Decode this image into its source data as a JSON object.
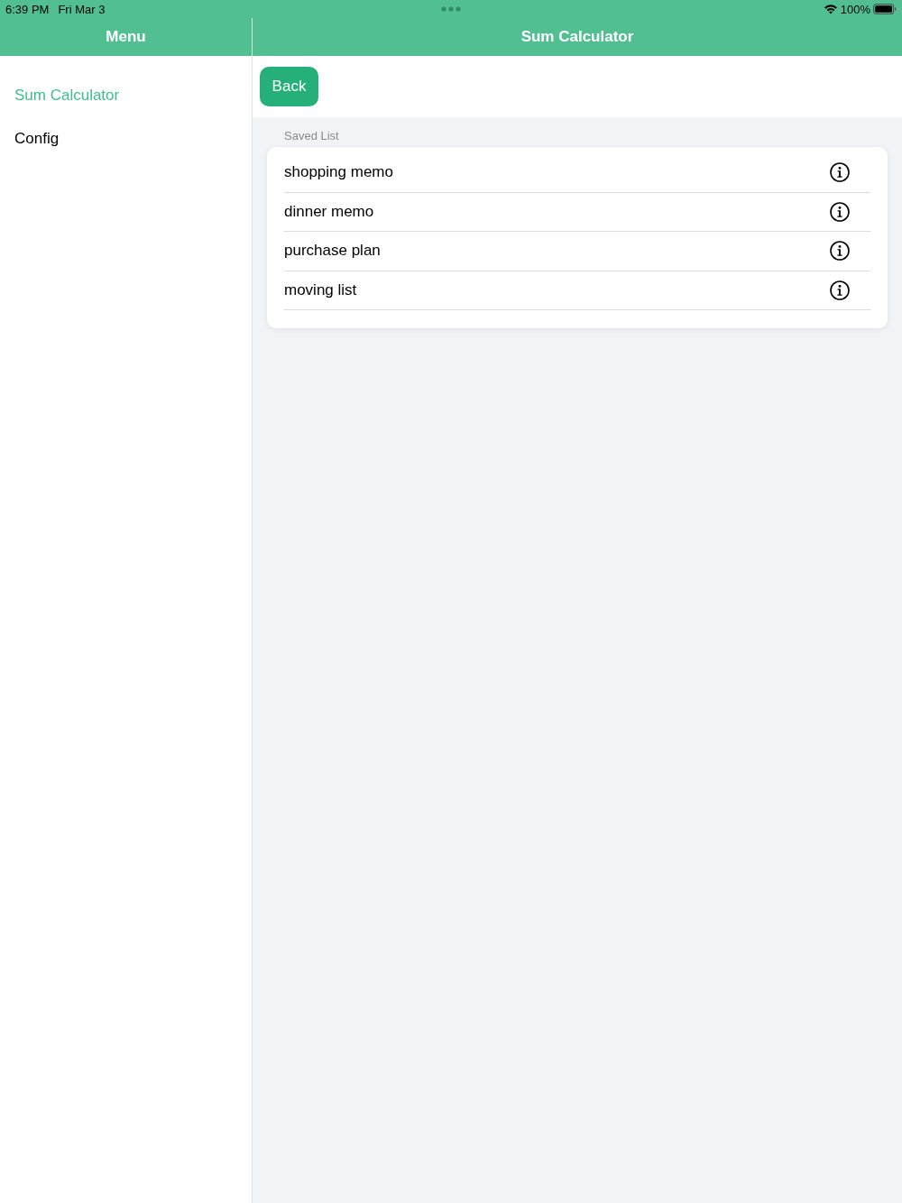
{
  "status_bar": {
    "time": "6:39 PM",
    "date": "Fri Mar 3",
    "battery": "100%"
  },
  "sidebar": {
    "title": "Menu",
    "items": [
      {
        "label": "Sum Calculator",
        "selected": true
      },
      {
        "label": "Config",
        "selected": false
      }
    ]
  },
  "main": {
    "title": "Sum Calculator",
    "back_button": "Back",
    "section_title": "Saved List",
    "items": [
      {
        "label": "shopping memo"
      },
      {
        "label": "dinner memo"
      },
      {
        "label": "purchase plan"
      },
      {
        "label": "moving list"
      }
    ]
  }
}
